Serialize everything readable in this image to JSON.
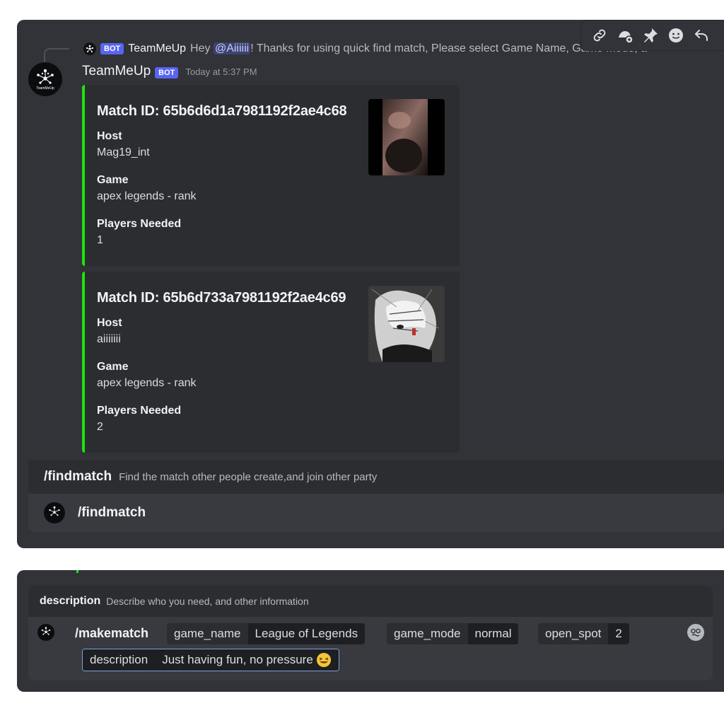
{
  "reply": {
    "bot_tag": "BOT",
    "author": "TeamMeUp",
    "text_prefix": "Hey ",
    "mention": "@Aiiiiii",
    "text_suffix": "! Thanks for using quick find match, Please select Game Name, Game Mode, a"
  },
  "message": {
    "author": "TeamMeUp",
    "bot_tag": "BOT",
    "timestamp": "Today at 5:37 PM",
    "embeds": [
      {
        "title": "Match ID: 65b6d6d1a7981192f2ae4c68",
        "fields": [
          {
            "name": "Host",
            "value": "Mag19_int"
          },
          {
            "name": "Game",
            "value": "apex legends - rank"
          },
          {
            "name": "Players Needed",
            "value": "1"
          }
        ],
        "accent": "#1fe30f"
      },
      {
        "title": "Match ID: 65b6d733a7981192f2ae4c69",
        "fields": [
          {
            "name": "Host",
            "value": "aiiiiiii"
          },
          {
            "name": "Game",
            "value": "apex legends - rank"
          },
          {
            "name": "Players Needed",
            "value": "2"
          }
        ],
        "accent": "#1fe30f"
      }
    ]
  },
  "command_hint": {
    "name": "/findmatch",
    "description": "Find the match other people create,and join other party"
  },
  "command_option": {
    "label": "/findmatch"
  },
  "param_hint": {
    "name": "description",
    "description": "Describe who you need, and other information"
  },
  "composer": {
    "command": "/makematch",
    "options": [
      {
        "key": "game_name",
        "value": "League of Legends"
      },
      {
        "key": "game_mode",
        "value": "normal"
      },
      {
        "key": "open_spot",
        "value": "2"
      },
      {
        "key": "description",
        "value": "Just having fun, no pressure"
      }
    ]
  },
  "toolbar_icons": [
    "link-icon",
    "reaction-add-icon",
    "pin-icon",
    "emoji-icon",
    "reply-icon"
  ],
  "colors": {
    "background": "#313338",
    "embed_bg": "#2b2d31",
    "accent_green": "#1fe30f",
    "bot_tag": "#5865f2",
    "mention_bg": "#3c4270"
  }
}
